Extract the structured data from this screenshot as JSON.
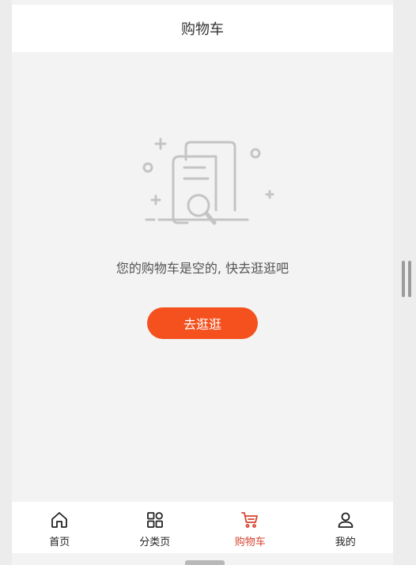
{
  "header": {
    "title": "购物车"
  },
  "empty_state": {
    "illustration": "empty-document-search-icon",
    "message": "您的购物车是空的, 快去逛逛吧",
    "button_label": "去逛逛"
  },
  "tabbar": {
    "items": [
      {
        "label": "首页",
        "icon": "home-icon",
        "active": false
      },
      {
        "label": "分类页",
        "icon": "category-grid-icon",
        "active": false
      },
      {
        "label": "购物车",
        "icon": "cart-icon",
        "active": true
      },
      {
        "label": "我的",
        "icon": "user-icon",
        "active": false
      }
    ]
  },
  "colors": {
    "accent": "#f4511e",
    "active_tab": "#d6432f",
    "background": "#f3f3f4"
  }
}
